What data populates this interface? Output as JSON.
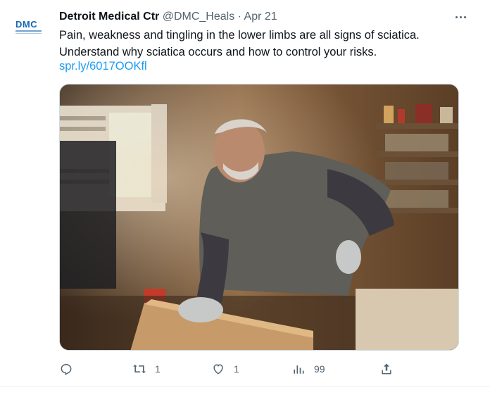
{
  "author": {
    "avatar_text": "DMC",
    "name": "Detroit Medical Ctr",
    "handle": "@DMC_Heals",
    "separator": "·",
    "date": "Apr 21"
  },
  "tweet": {
    "text": "Pain, weakness and tingling in the lower limbs are all signs of sciatica. Understand why sciatica occurs and how to control your risks.",
    "link": "spr.ly/6017OOKfl"
  },
  "actions": {
    "reply_count": "",
    "retweet_count": "1",
    "like_count": "1",
    "views_count": "99"
  },
  "icons": {
    "more": "more-dots-icon",
    "reply": "reply-icon",
    "retweet": "retweet-icon",
    "like": "heart-icon",
    "views": "views-icon",
    "share": "share-icon"
  },
  "colors": {
    "link": "#1d9bf0",
    "muted": "#536471",
    "brand": "#1466b3"
  }
}
